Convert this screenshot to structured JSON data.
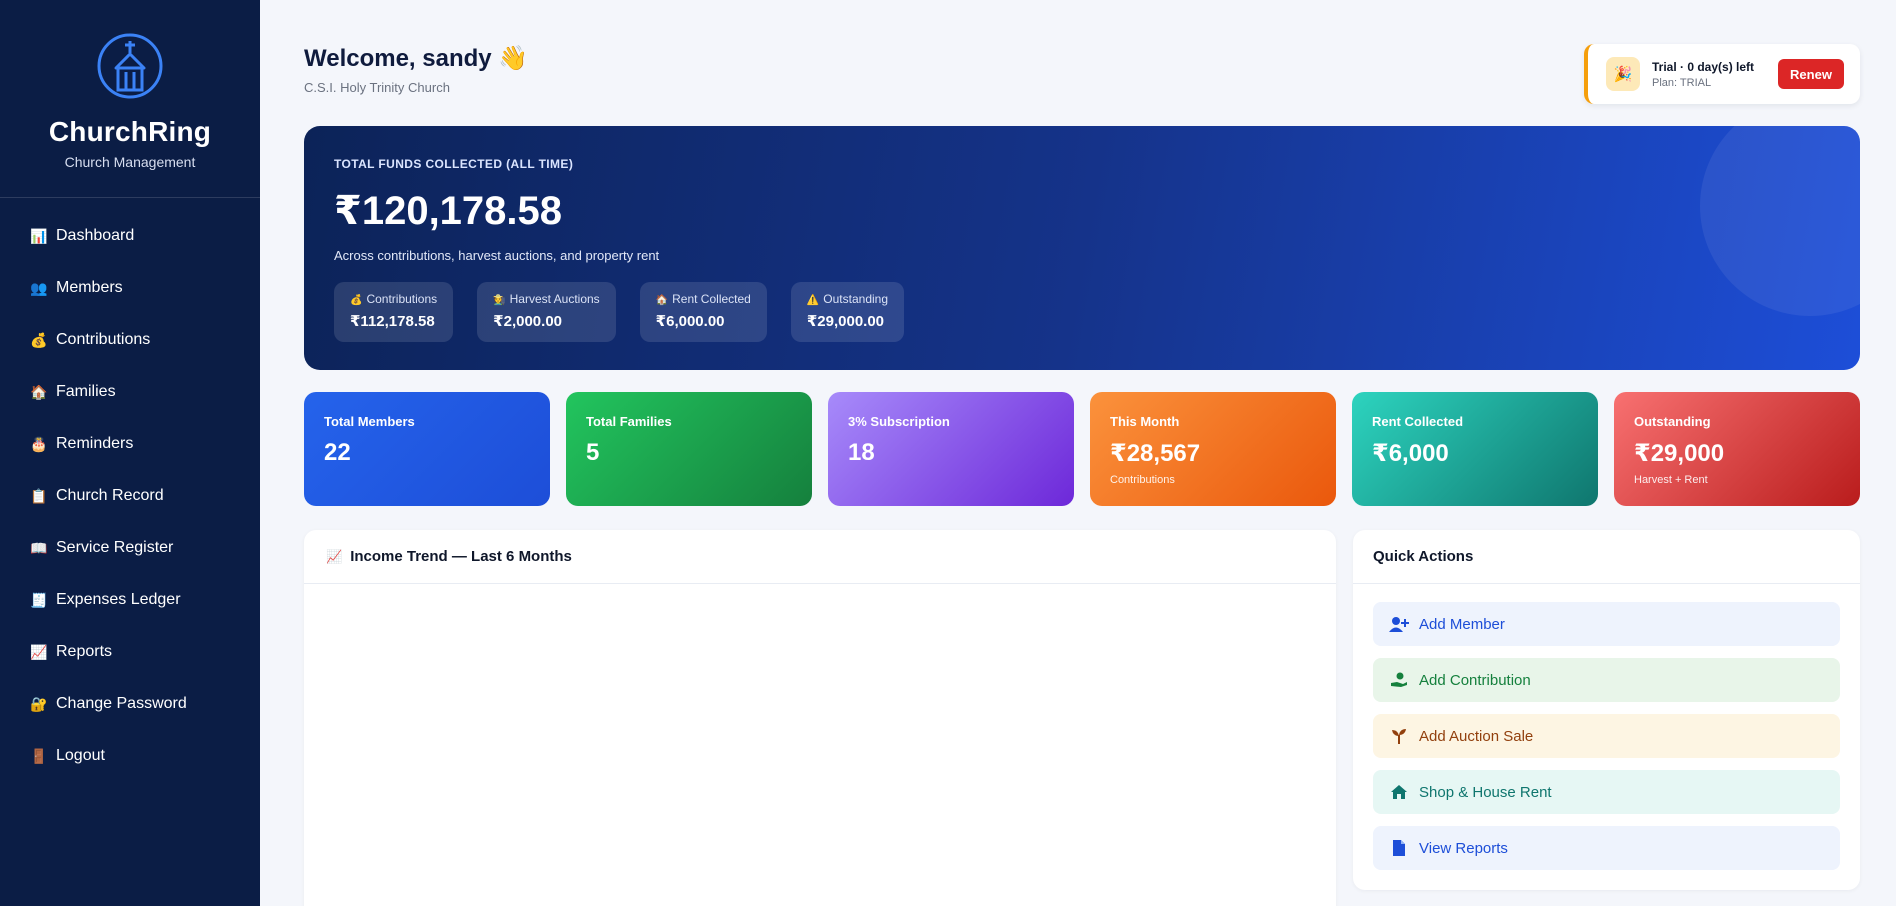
{
  "brand": {
    "name": "ChurchRing",
    "subtitle": "Church Management",
    "logo_icon": "church-icon"
  },
  "sidebar": {
    "items": [
      {
        "label": "Dashboard",
        "icon": "bar-chart-icon"
      },
      {
        "label": "Members",
        "icon": "people-icon"
      },
      {
        "label": "Contributions",
        "icon": "money-bag-icon"
      },
      {
        "label": "Families",
        "icon": "house-icon"
      },
      {
        "label": "Reminders",
        "icon": "cake-icon"
      },
      {
        "label": "Church Record",
        "icon": "document-icon"
      },
      {
        "label": "Service Register",
        "icon": "book-icon"
      },
      {
        "label": "Expenses Ledger",
        "icon": "receipt-icon"
      },
      {
        "label": "Reports",
        "icon": "chart-line-icon"
      },
      {
        "label": "Change Password",
        "icon": "lock-icon"
      },
      {
        "label": "Logout",
        "icon": "door-icon"
      }
    ]
  },
  "header": {
    "welcome": "Welcome, sandy 👋",
    "church_name": "C.S.I. Holy Trinity Church"
  },
  "trial": {
    "title": "Trial · 0 day(s) left",
    "plan": "Plan: TRIAL",
    "renew_label": "Renew",
    "icon": "party-popper-icon"
  },
  "hero": {
    "label": "TOTAL FUNDS COLLECTED (ALL TIME)",
    "amount": "₹120,178.58",
    "subtitle": "Across contributions, harvest auctions, and property rent",
    "chips": [
      {
        "label": "Contributions",
        "value": "₹112,178.58",
        "icon": "money-bag-icon"
      },
      {
        "label": "Harvest Auctions",
        "value": "₹2,000.00",
        "icon": "farmer-icon"
      },
      {
        "label": "Rent Collected",
        "value": "₹6,000.00",
        "icon": "house-icon"
      },
      {
        "label": "Outstanding",
        "value": "₹29,000.00",
        "icon": "warning-icon"
      }
    ]
  },
  "stats": [
    {
      "label": "Total Members",
      "value": "22",
      "note": ""
    },
    {
      "label": "Total Families",
      "value": "5",
      "note": ""
    },
    {
      "label": "3% Subscription",
      "value": "18",
      "note": ""
    },
    {
      "label": "This Month",
      "value": "₹28,567",
      "note": "Contributions"
    },
    {
      "label": "Rent Collected",
      "value": "₹6,000",
      "note": ""
    },
    {
      "label": "Outstanding",
      "value": "₹29,000",
      "note": "Harvest + Rent"
    }
  ],
  "income_trend": {
    "title": "Income Trend — Last 6 Months",
    "icon": "chart-line-icon"
  },
  "quick_actions": {
    "title": "Quick Actions",
    "items": [
      {
        "label": "Add Member",
        "icon": "user-plus-icon"
      },
      {
        "label": "Add Contribution",
        "icon": "hand-coin-icon"
      },
      {
        "label": "Add Auction Sale",
        "icon": "sprout-icon"
      },
      {
        "label": "Shop & House Rent",
        "icon": "home-icon"
      },
      {
        "label": "View Reports",
        "icon": "file-icon"
      }
    ]
  },
  "colors": {
    "sidebar": "#0b1d45",
    "accent": "#1d4ed8",
    "renew": "#dc2626",
    "trial_border": "#f59e0b"
  }
}
